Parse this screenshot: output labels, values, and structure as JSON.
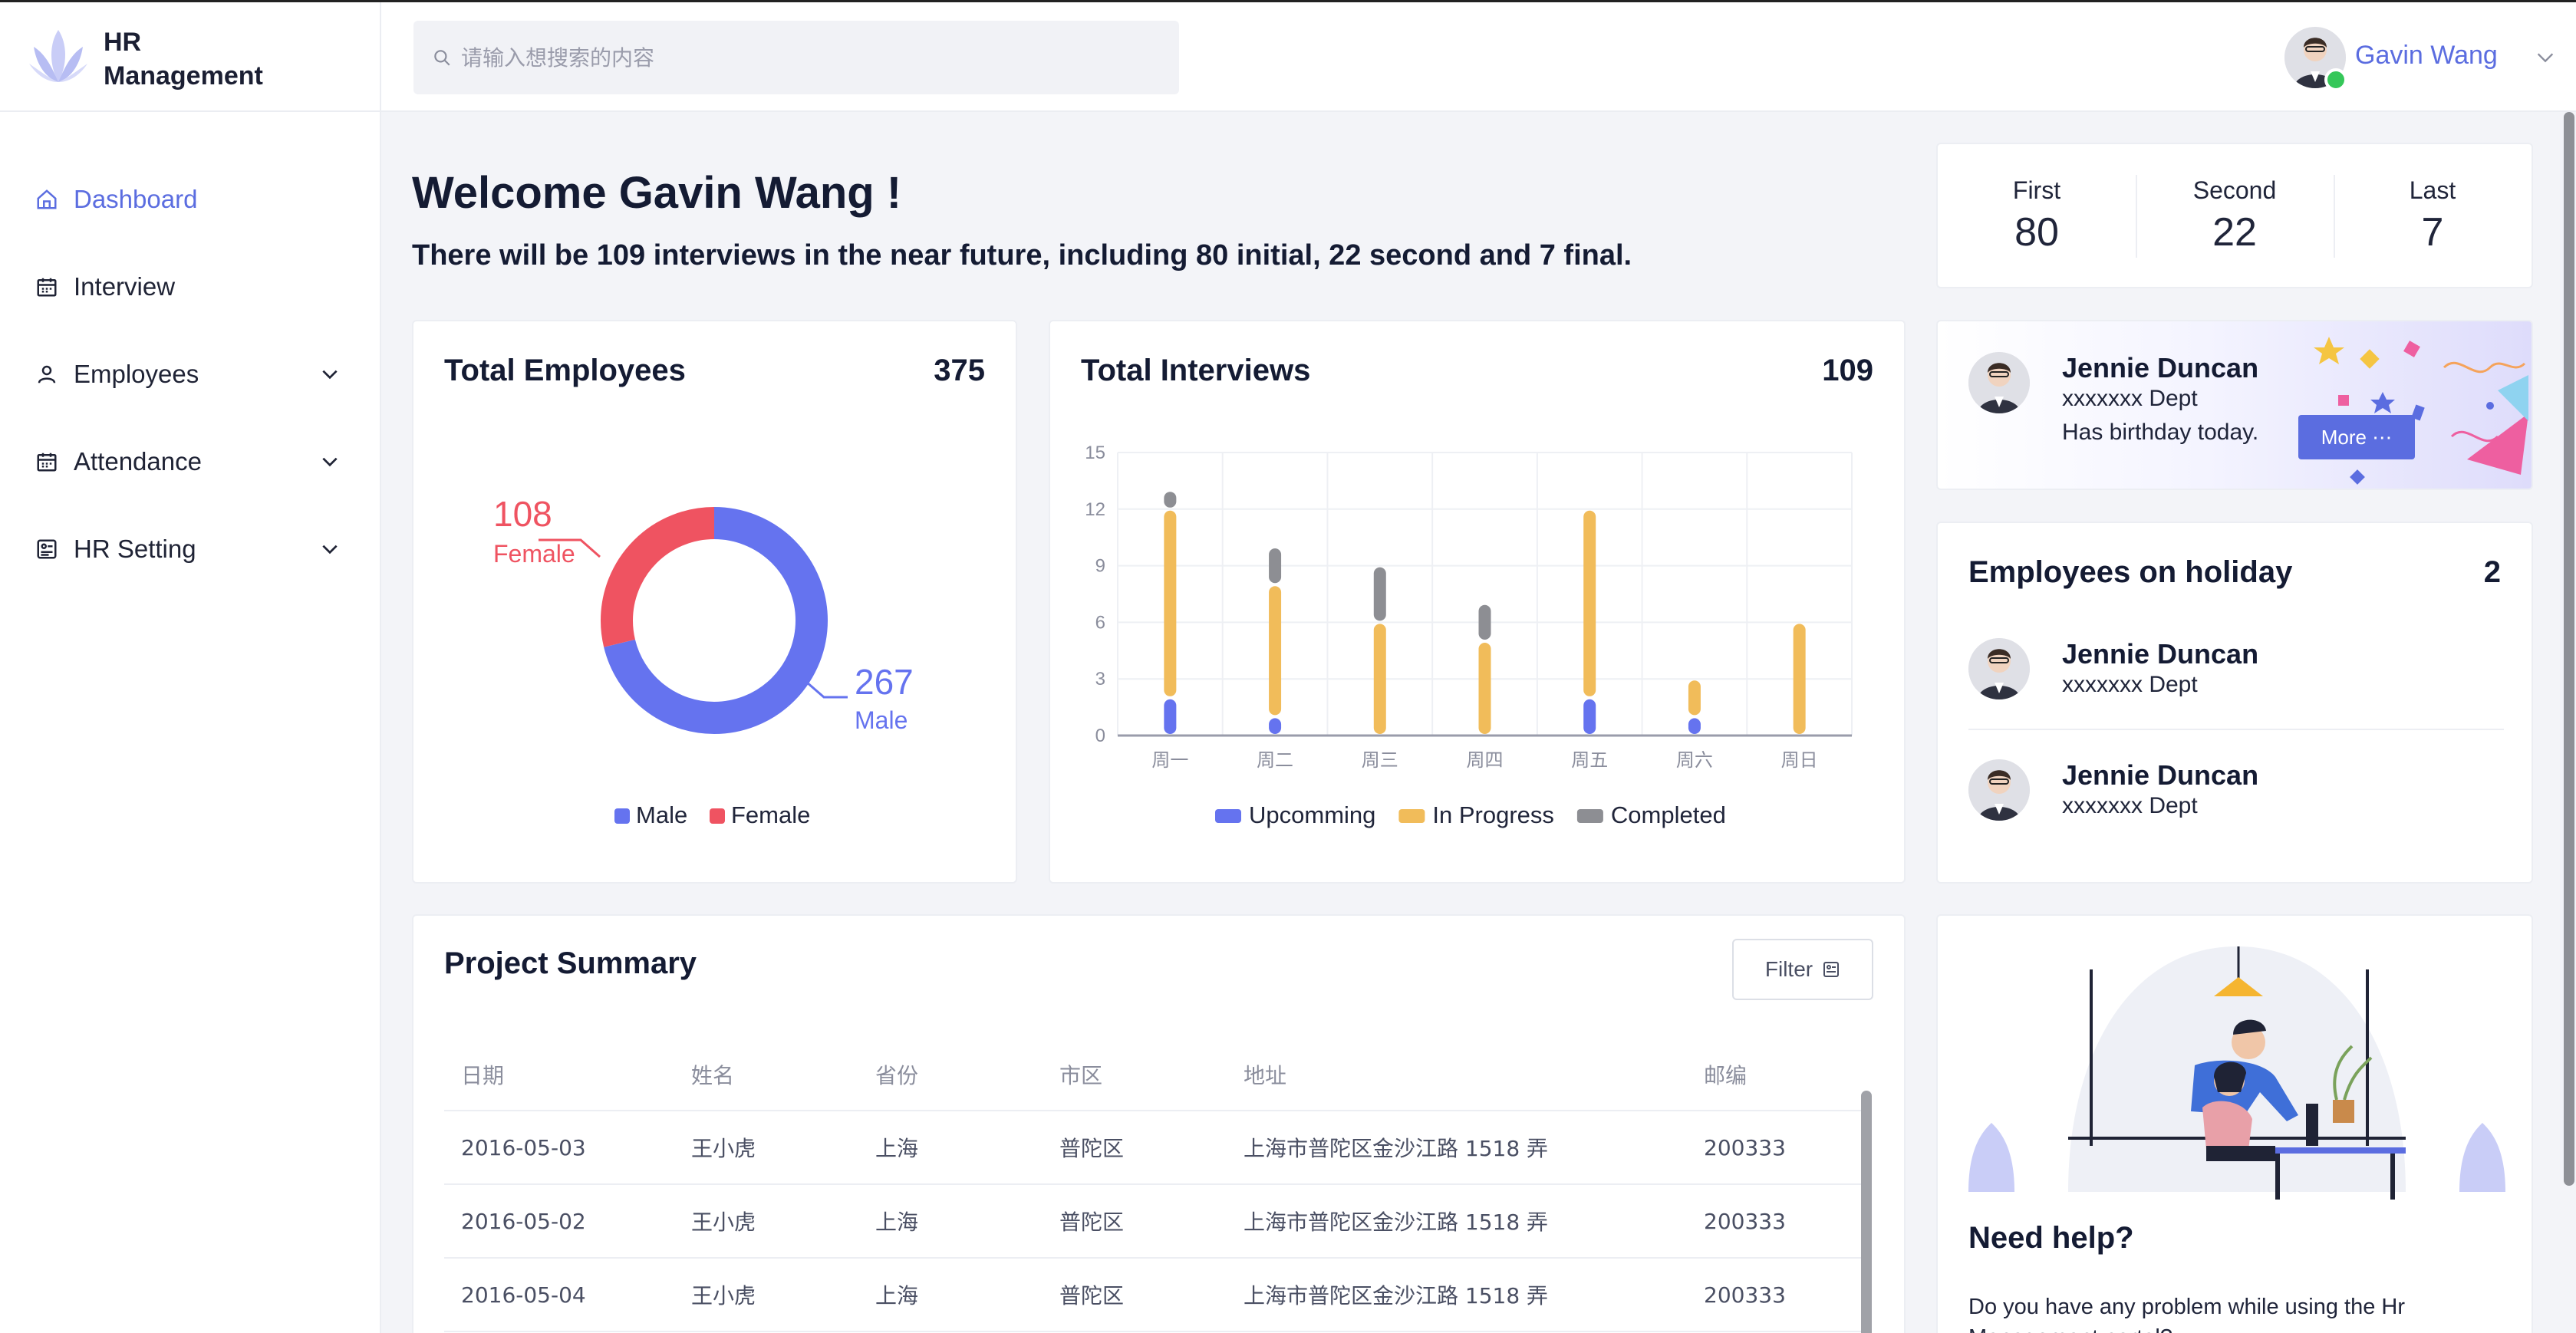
{
  "app": {
    "logo_line1": "HR",
    "logo_line2": "Management",
    "brand_color": "#5b6de0"
  },
  "sidebar": {
    "items": [
      {
        "label": "Dashboard",
        "icon": "home-icon",
        "active": true
      },
      {
        "label": "Interview",
        "icon": "calendar-icon"
      },
      {
        "label": "Employees",
        "icon": "user-icon",
        "expandable": true
      },
      {
        "label": "Attendance",
        "icon": "calendar-icon",
        "expandable": true
      },
      {
        "label": "HR Setting",
        "icon": "settings-card-icon",
        "expandable": true
      }
    ]
  },
  "header": {
    "search_placeholder": "请输入想搜索的内容",
    "user_name": "Gavin Wang"
  },
  "welcome": {
    "title": "Welcome Gavin Wang !",
    "subtitle": "There will be 109 interviews in the near future, including 80 initial, 22 second and 7 final."
  },
  "stats": [
    {
      "label": "First",
      "value": "80"
    },
    {
      "label": "Second",
      "value": "22"
    },
    {
      "label": "Last",
      "value": "7"
    }
  ],
  "employees_card": {
    "title": "Total Employees",
    "count": "375"
  },
  "interviews_card": {
    "title": "Total Interviews",
    "count": "109"
  },
  "chart_data": [
    {
      "type": "pie",
      "variant": "donut",
      "labels": [
        "Male",
        "Female"
      ],
      "values": [
        267,
        108
      ],
      "colors": [
        "#6573ef",
        "#ef5361"
      ],
      "legend": [
        "Male",
        "Female"
      ],
      "legend_position": "bottom"
    },
    {
      "type": "bar",
      "stacked": true,
      "categories": [
        "周一",
        "周二",
        "周三",
        "周四",
        "周五",
        "周六",
        "周日"
      ],
      "series": [
        {
          "name": "Upcomming",
          "values": [
            2,
            1,
            0,
            0,
            2,
            1,
            0
          ],
          "color": "#6573ef"
        },
        {
          "name": "In Progress",
          "values": [
            10,
            7,
            6,
            5,
            10,
            2,
            6
          ],
          "color": "#f1bc5a"
        },
        {
          "name": "Completed",
          "values": [
            1,
            2,
            3,
            2,
            0,
            0,
            0
          ],
          "color": "#8d8e93"
        }
      ],
      "yticks": [
        "0",
        "3",
        "6",
        "9",
        "12",
        "15"
      ],
      "ylim": [
        0,
        15
      ],
      "grid": true,
      "legend_position": "bottom"
    }
  ],
  "birthday": {
    "name": "Jennie Duncan",
    "dept": "xxxxxxx Dept",
    "note": "Has birthday today.",
    "more_label": "More"
  },
  "holiday": {
    "title": "Employees on holiday",
    "count": "2",
    "people": [
      {
        "name": "Jennie Duncan",
        "dept": "xxxxxxx Dept"
      },
      {
        "name": "Jennie Duncan",
        "dept": "xxxxxxx Dept"
      }
    ]
  },
  "project": {
    "title": "Project Summary",
    "filter_label": "Filter",
    "columns": [
      "日期",
      "姓名",
      "省份",
      "市区",
      "地址",
      "邮编"
    ],
    "rows": [
      [
        "2016-05-03",
        "王小虎",
        "上海",
        "普陀区",
        "上海市普陀区金沙江路 1518 弄",
        "200333"
      ],
      [
        "2016-05-02",
        "王小虎",
        "上海",
        "普陀区",
        "上海市普陀区金沙江路 1518 弄",
        "200333"
      ],
      [
        "2016-05-04",
        "王小虎",
        "上海",
        "普陀区",
        "上海市普陀区金沙江路 1518 弄",
        "200333"
      ]
    ]
  },
  "help": {
    "title": "Need help?",
    "text": "Do you have any problem while using the Hr Management portal?"
  }
}
